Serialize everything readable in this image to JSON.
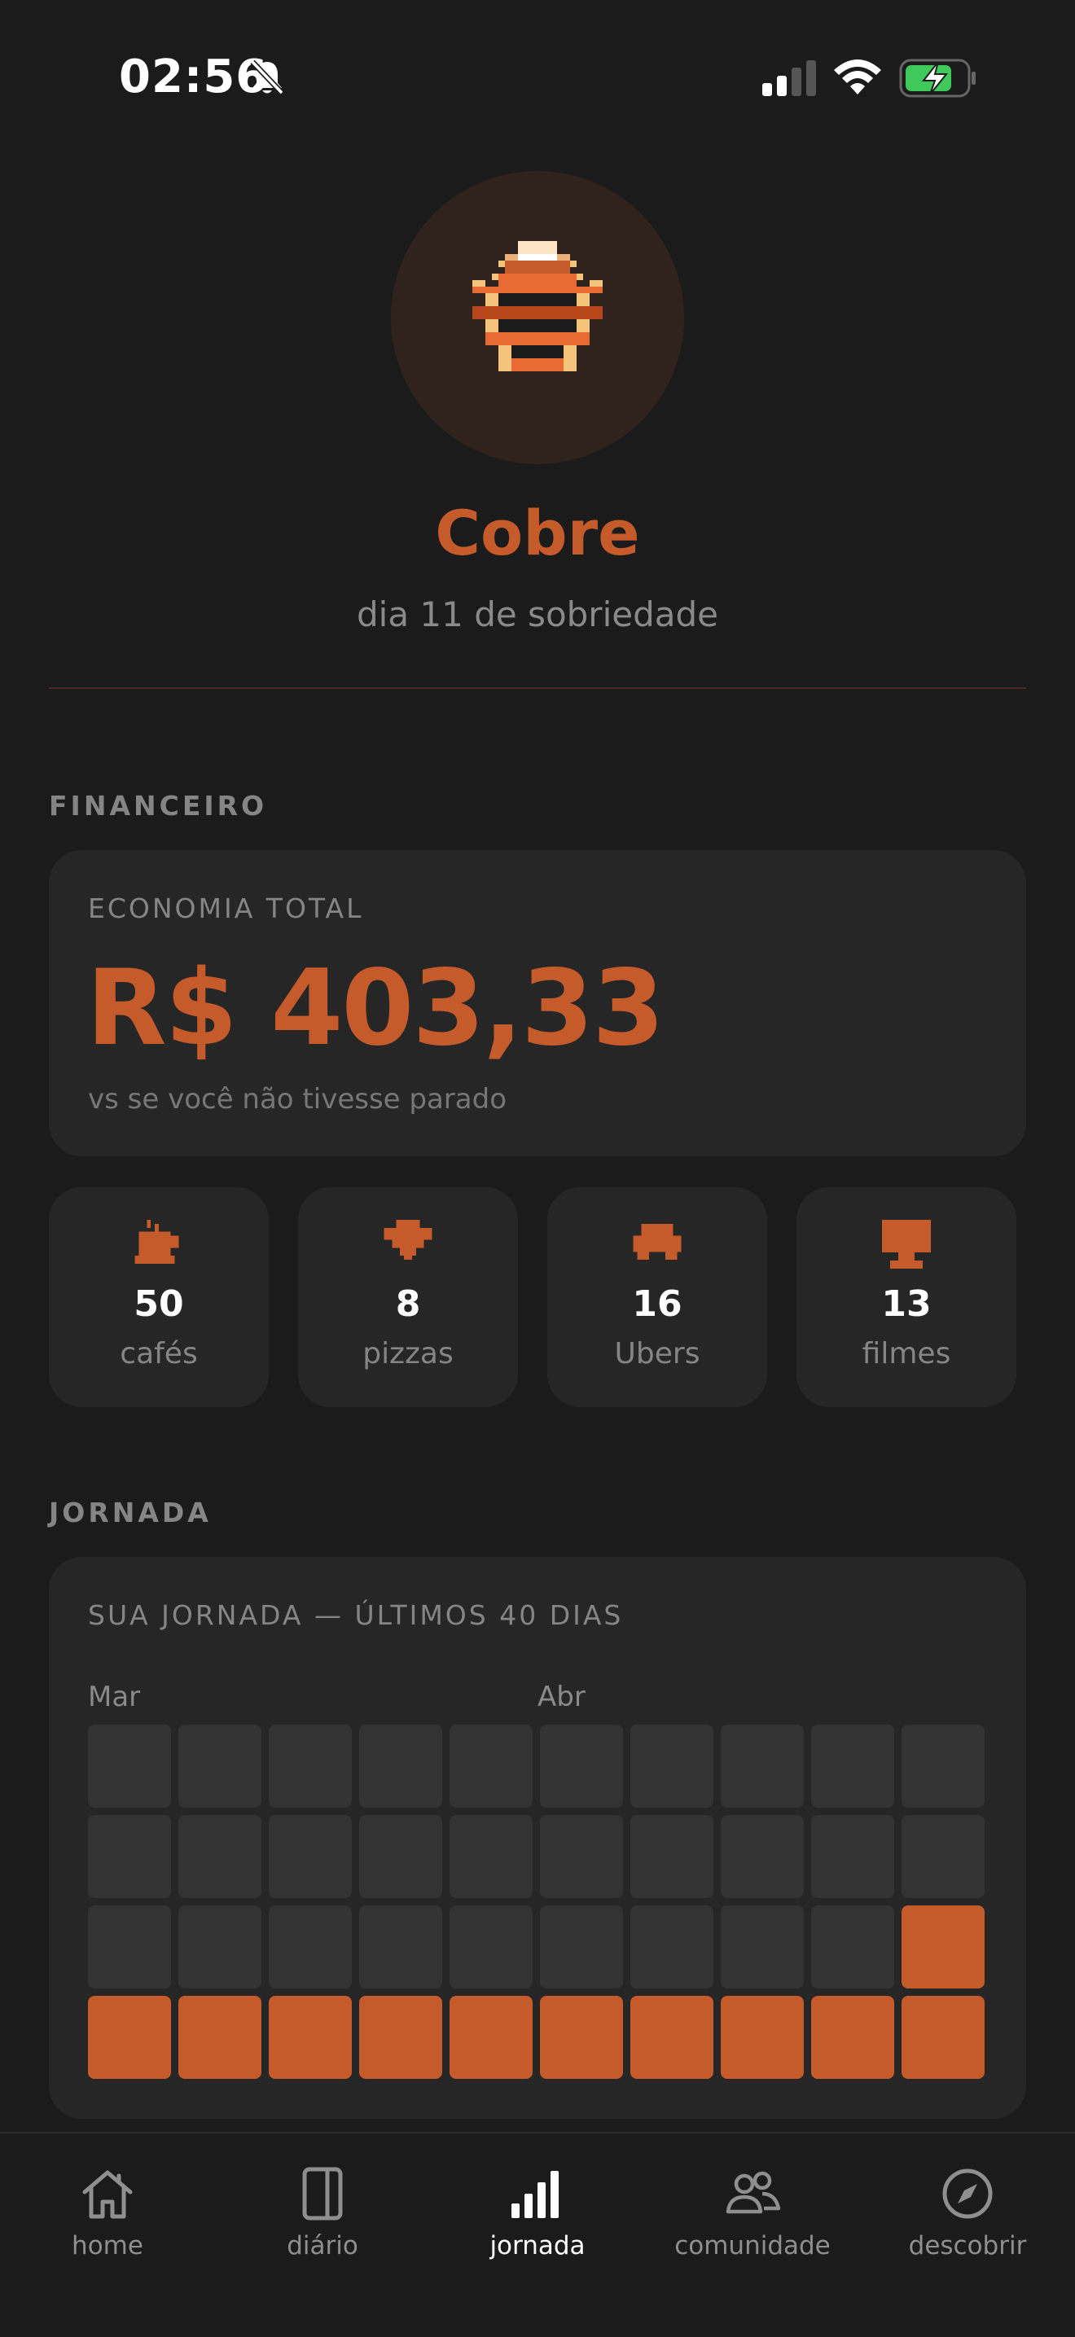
{
  "status_bar": {
    "time": "02:56"
  },
  "profile": {
    "name": "Cobre",
    "subtitle": "dia 11 de sobriedade",
    "accent": "#c55a2b"
  },
  "financeiro": {
    "section_label": "FINANCEIRO",
    "economia_label": "ECONOMIA TOTAL",
    "economia_value": "R$ 403,33",
    "economia_note": "vs se você não tivesse parado",
    "stats": [
      {
        "icon": "coffee-icon",
        "value": "50",
        "label": "cafés"
      },
      {
        "icon": "pizza-icon",
        "value": "8",
        "label": "pizzas"
      },
      {
        "icon": "car-icon",
        "value": "16",
        "label": "Ubers"
      },
      {
        "icon": "tv-icon",
        "value": "13",
        "label": "filmes"
      }
    ]
  },
  "jornada": {
    "section_label": "JORNADA",
    "title": "SUA JORNADA — ÚLTIMOS 40 DIAS",
    "months": [
      "Mar",
      "Abr"
    ],
    "total_days": 40,
    "sober_days": 11
  },
  "nav": {
    "items": [
      {
        "icon": "home-icon",
        "label": "home",
        "active": false
      },
      {
        "icon": "journal-icon",
        "label": "diário",
        "active": false
      },
      {
        "icon": "bar-chart-icon",
        "label": "jornada",
        "active": true
      },
      {
        "icon": "people-icon",
        "label": "comunidade",
        "active": false
      },
      {
        "icon": "compass-icon",
        "label": "descobrir",
        "active": false
      }
    ]
  }
}
